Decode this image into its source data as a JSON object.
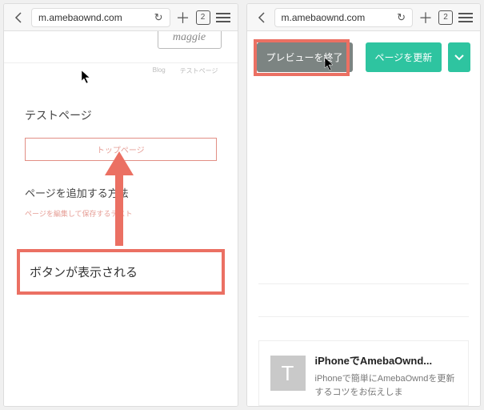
{
  "browser": {
    "url": "m.amebaownd.com",
    "tabs": "2"
  },
  "left": {
    "logo": "maggie",
    "nav": {
      "blog": "Blog",
      "test": "テストページ"
    },
    "page_title": "テストページ",
    "top_page_btn": "トップページ",
    "section_title": "ページを追加する方法",
    "small_text": "ページを編集して保存するテスト",
    "callout": "ボタンが表示される"
  },
  "right": {
    "exit_preview": "プレビューを終了",
    "update_page": "ページを更新",
    "card_title": "iPhoneでAmebaOwnd...",
    "card_desc": "iPhoneで簡単にAmebaOwndを更新するコツをお伝えしま"
  },
  "colors": {
    "accent_red": "#eb7063",
    "accent_green": "#2ec4a0",
    "grey_btn": "#7c8482"
  }
}
